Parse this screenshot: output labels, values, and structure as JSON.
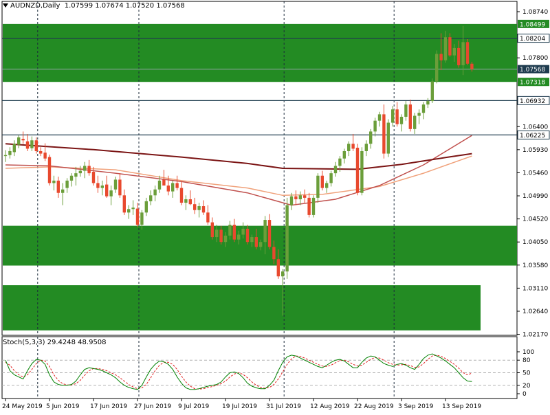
{
  "header": {
    "symbol": "AUDNZD,Daily",
    "ohlc": "1.07599 1.07674 1.07520 1.07568",
    "stoch": "Stoch(5,3,3) 29.4248 48.9508"
  },
  "colors": {
    "zone": "#238b23",
    "bull": "#6b9e3a",
    "bear": "#e8492e",
    "ma_long": "#7b1414",
    "ma_mid": "#c0504d",
    "ma_short": "#f0a17a",
    "stoch_main": "#008000",
    "stoch_signal": "#e02020",
    "level_line": "#1f3c4f",
    "price_tag": "#1f3c4f"
  },
  "chart_data": [
    {
      "type": "candlestick",
      "title": "AUDNZD,Daily",
      "ylim": [
        1.0215,
        1.0895
      ],
      "yticks": [
        "1.08740",
        "1.07800",
        "1.06400",
        "1.05930",
        "1.05460",
        "1.04990",
        "1.04520",
        "1.04050",
        "1.03580",
        "1.03110",
        "1.02640",
        "1.02170"
      ],
      "xticks": [
        "24 May 2019",
        "5 Jun 2019",
        "17 Jun 2019",
        "27 Jun 2019",
        "9 Jul 2019",
        "19 Jul 2019",
        "31 Jul 2019",
        "12 Aug 2019",
        "22 Aug 2019",
        "3 Sep 2019",
        "13 Sep 2019"
      ],
      "xtick_index": [
        0,
        10,
        20,
        30,
        40,
        50,
        60,
        70,
        80,
        90,
        100
      ],
      "period_separators": [
        7,
        30,
        63,
        88
      ],
      "zones": [
        [
          1.0731,
          1.0849
        ],
        [
          1.0357,
          1.0438
        ],
        [
          1.0225,
          1.0317
        ]
      ],
      "levels": [
        {
          "value": 1.082,
          "label": "1.08204"
        },
        {
          "value": 1.0693,
          "label": "1.06932"
        },
        {
          "value": 1.0623,
          "label": "1.06225"
        }
      ],
      "price_labels": [
        {
          "value": 1.0849,
          "label": "1.08499"
        },
        {
          "value": 1.0757,
          "label": "1.07568"
        },
        {
          "value": 1.0731,
          "label": "1.07318"
        }
      ],
      "ohlc": [
        [
          1.058,
          1.0592,
          1.0568,
          1.0582
        ],
        [
          1.0582,
          1.0598,
          1.0575,
          1.059
        ],
        [
          1.0588,
          1.0612,
          1.058,
          1.0605
        ],
        [
          1.0603,
          1.0622,
          1.0596,
          1.0618
        ],
        [
          1.0615,
          1.063,
          1.0605,
          1.0612
        ],
        [
          1.061,
          1.0625,
          1.059,
          1.0595
        ],
        [
          1.0596,
          1.062,
          1.059,
          1.0612
        ],
        [
          1.0612,
          1.0618,
          1.0585,
          1.059
        ],
        [
          1.059,
          1.0598,
          1.058,
          1.0585
        ],
        [
          1.0587,
          1.0606,
          1.057,
          1.0575
        ],
        [
          1.0578,
          1.0583,
          1.052,
          1.0525
        ],
        [
          1.0525,
          1.054,
          1.051,
          1.053
        ],
        [
          1.053,
          1.0538,
          1.0495,
          1.0505
        ],
        [
          1.0505,
          1.0525,
          1.048,
          1.0512
        ],
        [
          1.0515,
          1.0535,
          1.0505,
          1.053
        ],
        [
          1.053,
          1.0545,
          1.0518,
          1.054
        ],
        [
          1.0538,
          1.0558,
          1.052,
          1.0545
        ],
        [
          1.0545,
          1.056,
          1.0538,
          1.055
        ],
        [
          1.055,
          1.0568,
          1.0535,
          1.056
        ],
        [
          1.056,
          1.0572,
          1.054,
          1.0545
        ],
        [
          1.0548,
          1.0558,
          1.052,
          1.0525
        ],
        [
          1.0525,
          1.054,
          1.0505,
          1.0515
        ],
        [
          1.0515,
          1.053,
          1.05,
          1.052
        ],
        [
          1.0522,
          1.054,
          1.0495,
          1.0498
        ],
        [
          1.0498,
          1.052,
          1.048,
          1.051
        ],
        [
          1.0512,
          1.0538,
          1.0505,
          1.0532
        ],
        [
          1.0532,
          1.0545,
          1.0495,
          1.05
        ],
        [
          1.05,
          1.0512,
          1.046,
          1.0465
        ],
        [
          1.0465,
          1.048,
          1.0452,
          1.0472
        ],
        [
          1.0472,
          1.049,
          1.046,
          1.0475
        ],
        [
          1.0473,
          1.0485,
          1.0435,
          1.044
        ],
        [
          1.044,
          1.047,
          1.043,
          1.0465
        ],
        [
          1.0465,
          1.0495,
          1.0458,
          1.0488
        ],
        [
          1.0488,
          1.051,
          1.048,
          1.05
        ],
        [
          1.05,
          1.052,
          1.0488,
          1.0512
        ],
        [
          1.0512,
          1.054,
          1.0505,
          1.053
        ],
        [
          1.0532,
          1.0552,
          1.052,
          1.052
        ],
        [
          1.052,
          1.054,
          1.05,
          1.0508
        ],
        [
          1.0508,
          1.053,
          1.0495,
          1.0525
        ],
        [
          1.0525,
          1.054,
          1.051,
          1.0515
        ],
        [
          1.0515,
          1.0528,
          1.048,
          1.0485
        ],
        [
          1.0485,
          1.05,
          1.047,
          1.0492
        ],
        [
          1.0492,
          1.051,
          1.048,
          1.0482
        ],
        [
          1.0482,
          1.0495,
          1.0462,
          1.047
        ],
        [
          1.047,
          1.0485,
          1.0455,
          1.0478
        ],
        [
          1.0478,
          1.049,
          1.046,
          1.0465
        ],
        [
          1.0465,
          1.048,
          1.044,
          1.0445
        ],
        [
          1.0445,
          1.0455,
          1.041,
          1.0415
        ],
        [
          1.0415,
          1.044,
          1.0405,
          1.043
        ],
        [
          1.043,
          1.0438,
          1.04,
          1.0405
        ],
        [
          1.0405,
          1.0425,
          1.0395,
          1.0418
        ],
        [
          1.0418,
          1.0448,
          1.041,
          1.044
        ],
        [
          1.044,
          1.0452,
          1.0405,
          1.041
        ],
        [
          1.041,
          1.0428,
          1.04,
          1.042
        ],
        [
          1.042,
          1.0445,
          1.0412,
          1.0432
        ],
        [
          1.0432,
          1.044,
          1.04,
          1.0405
        ],
        [
          1.0405,
          1.042,
          1.0395,
          1.0415
        ],
        [
          1.0415,
          1.0432,
          1.039,
          1.0395
        ],
        [
          1.0395,
          1.041,
          1.0388,
          1.0405
        ],
        [
          1.0405,
          1.0458,
          1.038,
          1.045
        ],
        [
          1.045,
          1.0462,
          1.039,
          1.0395
        ],
        [
          1.0395,
          1.0408,
          1.036,
          1.037
        ],
        [
          1.037,
          1.039,
          1.033,
          1.0335
        ],
        [
          1.0335,
          1.035,
          1.0255,
          1.0345
        ],
        [
          1.0345,
          1.0495,
          1.033,
          1.048
        ],
        [
          1.048,
          1.0505,
          1.047,
          1.0498
        ],
        [
          1.0498,
          1.051,
          1.048,
          1.0492
        ],
        [
          1.0492,
          1.0508,
          1.048,
          1.05
        ],
        [
          1.05,
          1.0512,
          1.0485,
          1.0495
        ],
        [
          1.0495,
          1.0505,
          1.0455,
          1.046
        ],
        [
          1.046,
          1.05,
          1.0455,
          1.0495
        ],
        [
          1.0495,
          1.0545,
          1.0485,
          1.054
        ],
        [
          1.054,
          1.055,
          1.051,
          1.0515
        ],
        [
          1.0515,
          1.053,
          1.0505,
          1.0525
        ],
        [
          1.0525,
          1.055,
          1.0518,
          1.0545
        ],
        [
          1.0545,
          1.0568,
          1.0538,
          1.056
        ],
        [
          1.056,
          1.058,
          1.0548,
          1.0575
        ],
        [
          1.0575,
          1.0595,
          1.0565,
          1.059
        ],
        [
          1.059,
          1.061,
          1.058,
          1.0605
        ],
        [
          1.0605,
          1.0625,
          1.059,
          1.0595
        ],
        [
          1.0597,
          1.0605,
          1.05,
          1.0505
        ],
        [
          1.0505,
          1.0598,
          1.05,
          1.059
        ],
        [
          1.059,
          1.0612,
          1.058,
          1.0605
        ],
        [
          1.0605,
          1.0635,
          1.0595,
          1.063
        ],
        [
          1.063,
          1.0658,
          1.062,
          1.0652
        ],
        [
          1.0652,
          1.067,
          1.064,
          1.0665
        ],
        [
          1.0665,
          1.0685,
          1.0575,
          1.0585
        ],
        [
          1.0585,
          1.0655,
          1.0578,
          1.0648
        ],
        [
          1.0648,
          1.0682,
          1.064,
          1.0675
        ],
        [
          1.0675,
          1.069,
          1.064,
          1.0645
        ],
        [
          1.0645,
          1.0665,
          1.063,
          1.066
        ],
        [
          1.066,
          1.0692,
          1.0652,
          1.0685
        ],
        [
          1.0685,
          1.0695,
          1.063,
          1.0635
        ],
        [
          1.0635,
          1.0668,
          1.0625,
          1.0662
        ],
        [
          1.0662,
          1.0675,
          1.0645,
          1.0668
        ],
        [
          1.0668,
          1.069,
          1.0655,
          1.0685
        ],
        [
          1.0685,
          1.0698,
          1.0678,
          1.0692
        ],
        [
          1.0692,
          1.0738,
          1.0688,
          1.0732
        ],
        [
          1.0732,
          1.0795,
          1.0728,
          1.0788
        ],
        [
          1.0788,
          1.083,
          1.0755,
          1.0775
        ],
        [
          1.0775,
          1.0835,
          1.077,
          1.0822
        ],
        [
          1.0822,
          1.083,
          1.0782,
          1.0785
        ],
        [
          1.0785,
          1.0808,
          1.0772,
          1.08
        ],
        [
          1.08,
          1.0815,
          1.076,
          1.0765
        ],
        [
          1.0765,
          1.0845,
          1.0745,
          1.0812
        ],
        [
          1.0812,
          1.0818,
          1.0765,
          1.0768
        ],
        [
          1.0768,
          1.0772,
          1.0752,
          1.0757
        ]
      ],
      "ma_long": [
        [
          0,
          1.0605
        ],
        [
          20,
          1.0593
        ],
        [
          40,
          1.0578
        ],
        [
          55,
          1.0565
        ],
        [
          63,
          1.0555
        ],
        [
          80,
          1.0553
        ],
        [
          90,
          1.0563
        ],
        [
          100,
          1.0577
        ],
        [
          106,
          1.0585
        ]
      ],
      "ma_mid": [
        [
          0,
          1.0562
        ],
        [
          10,
          1.056
        ],
        [
          25,
          1.0545
        ],
        [
          40,
          1.0528
        ],
        [
          55,
          1.0505
        ],
        [
          65,
          1.048
        ],
        [
          75,
          1.0492
        ],
        [
          85,
          1.052
        ],
        [
          95,
          1.0562
        ],
        [
          106,
          1.0622
        ]
      ],
      "ma_short": [
        [
          0,
          1.0555
        ],
        [
          10,
          1.0558
        ],
        [
          25,
          1.0552
        ],
        [
          40,
          1.053
        ],
        [
          55,
          1.0515
        ],
        [
          63,
          1.05
        ],
        [
          72,
          1.0502
        ],
        [
          85,
          1.0518
        ],
        [
          95,
          1.0545
        ],
        [
          106,
          1.058
        ]
      ]
    },
    {
      "type": "line",
      "title": "Stoch(5,3,3) 29.4248 48.9508",
      "ylim": [
        0,
        100
      ],
      "yticks": [
        100,
        80,
        50,
        20,
        0
      ],
      "series": [
        {
          "values": [
            80,
            55,
            45,
            40,
            35,
            55,
            72,
            82,
            80,
            70,
            45,
            28,
            22,
            20,
            20,
            22,
            30,
            45,
            58,
            62,
            60,
            58,
            55,
            50,
            45,
            38,
            28,
            20,
            15,
            12,
            10,
            20,
            40,
            58,
            70,
            78,
            76,
            70,
            58,
            40,
            25,
            14,
            10,
            10,
            12,
            15,
            18,
            20,
            22,
            28,
            40,
            50,
            52,
            48,
            38,
            25,
            18,
            14,
            12,
            12,
            20,
            32,
            55,
            75,
            88,
            92,
            90,
            85,
            80,
            75,
            70,
            65,
            62,
            68,
            75,
            80,
            82,
            78,
            70,
            62,
            62,
            75,
            85,
            90,
            88,
            80,
            72,
            68,
            65,
            70,
            72,
            68,
            62,
            58,
            70,
            84,
            92,
            95,
            90,
            85,
            78,
            70,
            62,
            50,
            38,
            30,
            29
          ]
        },
        {
          "values": [
            75,
            68,
            55,
            45,
            40,
            45,
            58,
            72,
            80,
            78,
            65,
            45,
            32,
            24,
            21,
            21,
            24,
            32,
            44,
            55,
            60,
            60,
            58,
            55,
            50,
            45,
            38,
            30,
            22,
            16,
            12,
            14,
            22,
            38,
            55,
            68,
            75,
            75,
            70,
            58,
            42,
            28,
            18,
            12,
            11,
            12,
            15,
            17,
            20,
            24,
            30,
            40,
            47,
            50,
            46,
            38,
            28,
            20,
            15,
            13,
            15,
            22,
            35,
            52,
            70,
            83,
            90,
            89,
            85,
            80,
            75,
            70,
            66,
            65,
            68,
            74,
            79,
            80,
            76,
            70,
            66,
            68,
            75,
            82,
            86,
            85,
            80,
            74,
            70,
            68,
            69,
            70,
            67,
            63,
            64,
            72,
            82,
            90,
            92,
            89,
            84,
            77,
            70,
            61,
            50,
            45,
            49
          ]
        }
      ]
    }
  ],
  "axis_labels": {
    "price": [
      "1.08740",
      "1.07800",
      "1.06400",
      "1.05930",
      "1.05460",
      "1.04990",
      "1.04520",
      "1.04050",
      "1.03580",
      "1.03110",
      "1.02640",
      "1.02170"
    ],
    "stoch": [
      "100",
      "80",
      "50",
      "20",
      "0"
    ],
    "time": [
      "24 May 2019",
      "5 Jun 2019",
      "17 Jun 2019",
      "27 Jun 2019",
      "9 Jul 2019",
      "19 Jul 2019",
      "31 Jul 2019",
      "12 Aug 2019",
      "22 Aug 2019",
      "3 Sep 2019",
      "13 Sep 2019"
    ]
  }
}
